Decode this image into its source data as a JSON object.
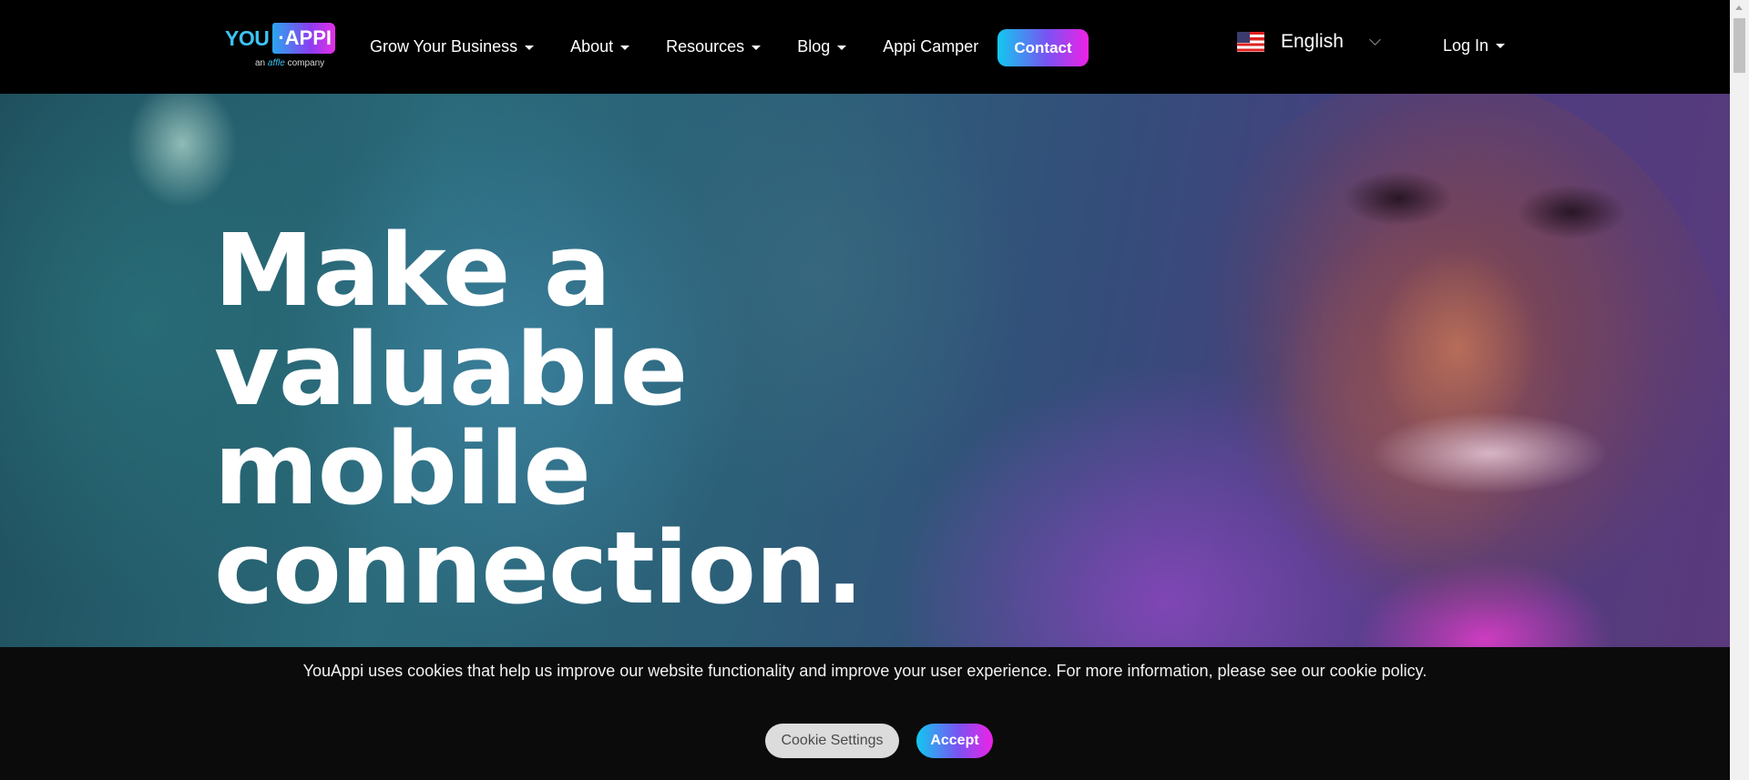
{
  "brand": {
    "logo_you": "YOU",
    "logo_appi": "·APPI",
    "logo_sub_prefix": "an",
    "logo_sub_affle": "affle",
    "logo_sub_suffix": "company",
    "accent_gradient": [
      "#12c8f0",
      "#7a52f2",
      "#ee22e6"
    ]
  },
  "nav": {
    "items": [
      {
        "label": "Grow Your Business",
        "has_dropdown": true
      },
      {
        "label": "About",
        "has_dropdown": true
      },
      {
        "label": "Resources",
        "has_dropdown": true
      },
      {
        "label": "Blog",
        "has_dropdown": true
      },
      {
        "label": "Appi Camper",
        "has_dropdown": false
      }
    ],
    "contact_label": "Contact",
    "language": {
      "label": "English",
      "flag_icon": "us-flag-icon"
    },
    "login_label": "Log In"
  },
  "hero": {
    "headline": [
      "Make a",
      "valuable",
      "mobile",
      "connection."
    ]
  },
  "cookie_banner": {
    "text": "YouAppi uses cookies that help us improve our website functionality and improve your user experience. For more information, please see our cookie policy.",
    "settings_label": "Cookie Settings",
    "accept_label": "Accept"
  }
}
